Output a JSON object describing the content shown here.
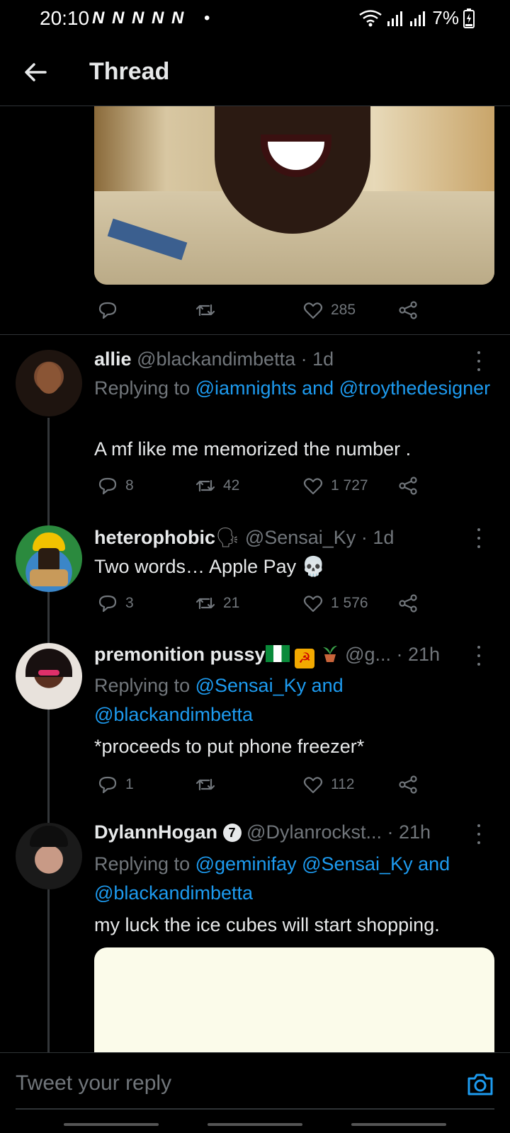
{
  "status_bar": {
    "time": "20:10",
    "notifications": "N N N N N",
    "dot": "•",
    "battery": "7%"
  },
  "header": {
    "title": "Thread"
  },
  "top_tweet": {
    "likes": "285"
  },
  "tweets": [
    {
      "name": "allie",
      "handle": "@blackandimbetta",
      "time": "· 1d",
      "replying_prefix": "Replying to",
      "mentions": "@iamnights and @troythedesigner",
      "text": "A mf like me memorized the number .",
      "replies": "8",
      "retweets": "42",
      "likes": "1 727"
    },
    {
      "name": "heterophobic",
      "name_emoji": "🗣",
      "handle": "@Sensai_Ky",
      "time": "· 1d",
      "text": "Two words… Apple Pay 💀",
      "replies": "3",
      "retweets": "21",
      "likes": "1 576"
    },
    {
      "name": "premonition pussy",
      "handle": "@g...",
      "time": "· 21h",
      "replying_prefix": "Replying to",
      "mentions": "@Sensai_Ky and @blackandimbetta",
      "text": "*proceeds to put phone freezer*",
      "replies": "1",
      "retweets": "",
      "likes": "112"
    },
    {
      "name": "DylannHogan",
      "badge": "7",
      "handle": "@Dylanrockst...",
      "time": "· 21h",
      "replying_prefix": "Replying to",
      "mentions": "@geminifay @Sensai_Ky and @blackandimbetta",
      "text": "my luck the ice cubes will start shopping."
    }
  ],
  "composer": {
    "placeholder": "Tweet your reply"
  },
  "colors": {
    "background": "#000000",
    "mention": "#1d9bf0",
    "muted": "#71767b",
    "text": "#e7e9ea"
  }
}
